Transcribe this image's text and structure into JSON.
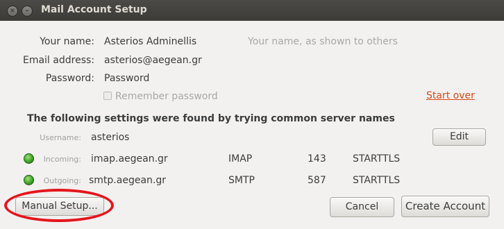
{
  "window": {
    "title": "Mail Account Setup"
  },
  "form": {
    "name_label": "Your name:",
    "name_value": "Asterios Adminellis",
    "name_hint": "Your name, as shown to others",
    "email_label": "Email address:",
    "email_value": "asterios@aegean.gr",
    "password_label": "Password:",
    "password_value": "Password",
    "remember_label": "Remember password",
    "start_over": "Start over"
  },
  "found": {
    "heading": "The following settings were found by trying common server names",
    "username_label": "Username:",
    "username_value": "asterios",
    "edit_label": "Edit",
    "incoming": {
      "label": "Incoming:",
      "server": "imap.aegean.gr",
      "protocol": "IMAP",
      "port": "143",
      "security": "STARTTLS",
      "status_color": "#3a9d23"
    },
    "outgoing": {
      "label": "Outgoing:",
      "server": "smtp.aegean.gr",
      "protocol": "SMTP",
      "port": "587",
      "security": "STARTTLS",
      "status_color": "#3a9d23"
    }
  },
  "buttons": {
    "manual_setup": "Manual Setup...",
    "cancel": "Cancel",
    "create_account": "Create Account"
  },
  "annotation": {
    "color": "#e4151b"
  }
}
